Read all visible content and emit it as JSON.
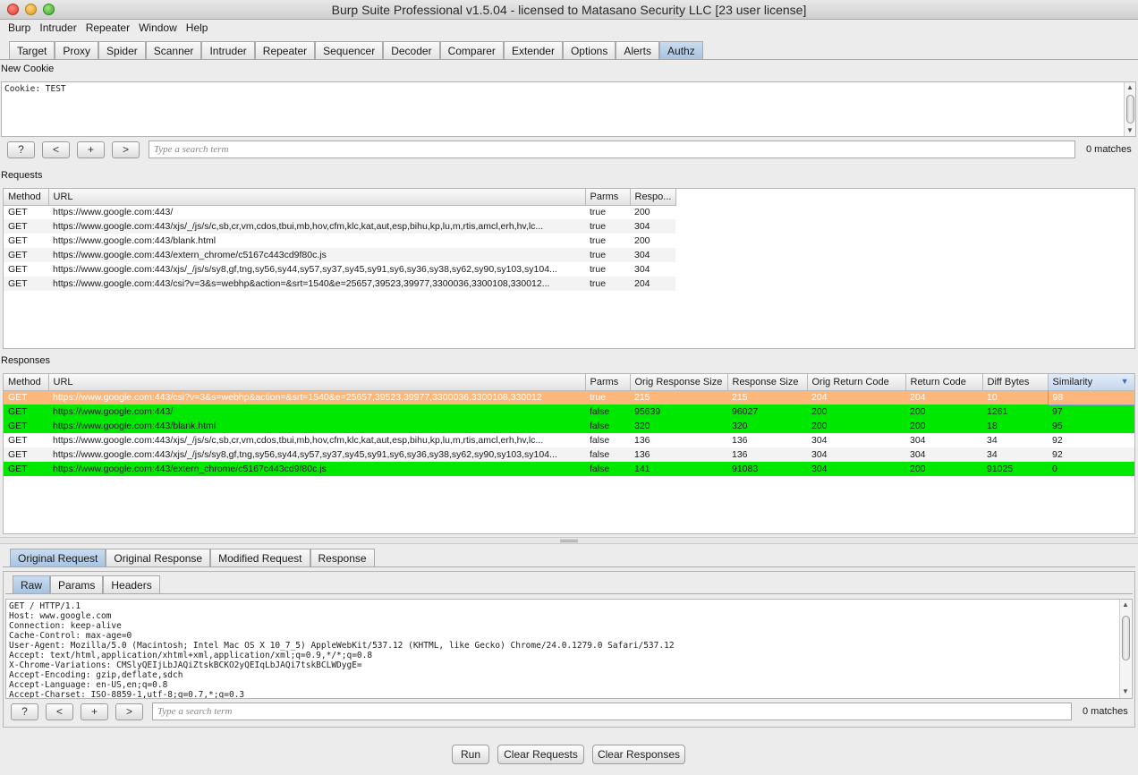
{
  "window": {
    "title": "Burp Suite Professional v1.5.04 - licensed to Matasano Security LLC [23 user license]"
  },
  "menu": [
    "Burp",
    "Intruder",
    "Repeater",
    "Window",
    "Help"
  ],
  "main_tabs": [
    "Target",
    "Proxy",
    "Spider",
    "Scanner",
    "Intruder",
    "Repeater",
    "Sequencer",
    "Decoder",
    "Comparer",
    "Extender",
    "Options",
    "Alerts",
    "Authz"
  ],
  "active_main_tab": "Authz",
  "new_cookie": {
    "label": "New Cookie",
    "value": "Cookie: TEST",
    "search": {
      "help": "?",
      "prev": "<",
      "add": "+",
      "next": ">",
      "placeholder": "Type a search term",
      "matches": "0 matches"
    }
  },
  "requests": {
    "label": "Requests",
    "columns": [
      "Method",
      "URL",
      "Parms",
      "Respo..."
    ],
    "rows": [
      [
        "GET",
        "https://www.google.com:443/",
        "true",
        "200"
      ],
      [
        "GET",
        "https://www.google.com:443/xjs/_/js/s/c,sb,cr,vm,cdos,tbui,mb,hov,cfm,klc,kat,aut,esp,bihu,kp,lu,m,rtis,amcl,erh,hv,lc...",
        "true",
        "304"
      ],
      [
        "GET",
        "https://www.google.com:443/blank.html",
        "true",
        "200"
      ],
      [
        "GET",
        "https://www.google.com:443/extern_chrome/c5167c443cd9f80c.js",
        "true",
        "304"
      ],
      [
        "GET",
        "https://www.google.com:443/xjs/_/js/s/sy8,gf,tng,sy56,sy44,sy57,sy37,sy45,sy91,sy6,sy36,sy38,sy62,sy90,sy103,sy104...",
        "true",
        "304"
      ],
      [
        "GET",
        "https://www.google.com:443/csi?v=3&s=webhp&action=&srt=1540&e=25657,39523,39977,3300036,3300108,330012...",
        "true",
        "204"
      ]
    ]
  },
  "responses": {
    "label": "Responses",
    "columns": [
      "Method",
      "URL",
      "Parms",
      "Orig Response Size",
      "Response Size",
      "Orig Return Code",
      "Return Code",
      "Diff Bytes",
      "Similarity"
    ],
    "sort_icon": "sort-descending-icon",
    "rows": [
      {
        "style": "orange",
        "cells": [
          "GET",
          "https://www.google.com:443/csi?v=3&s=webhp&action=&srt=1540&e=25657,39523,39977,3300036,3300108,330012",
          "true",
          "215",
          "215",
          "204",
          "204",
          "10",
          "98"
        ]
      },
      {
        "style": "green",
        "cells": [
          "GET",
          "https://www.google.com:443/",
          "false",
          "95639",
          "96027",
          "200",
          "200",
          "1261",
          "97"
        ]
      },
      {
        "style": "green",
        "cells": [
          "GET",
          "https://www.google.com:443/blank.html",
          "false",
          "320",
          "320",
          "200",
          "200",
          "18",
          "95"
        ]
      },
      {
        "style": "white",
        "cells": [
          "GET",
          "https://www.google.com:443/xjs/_/js/s/c,sb,cr,vm,cdos,tbui,mb,hov,cfm,klc,kat,aut,esp,bihu,kp,lu,m,rtis,amcl,erh,hv,lc...",
          "false",
          "136",
          "136",
          "304",
          "304",
          "34",
          "92"
        ]
      },
      {
        "style": "alt",
        "cells": [
          "GET",
          "https://www.google.com:443/xjs/_/js/s/sy8,gf,tng,sy56,sy44,sy57,sy37,sy45,sy91,sy6,sy36,sy38,sy62,sy90,sy103,sy104...",
          "false",
          "136",
          "136",
          "304",
          "304",
          "34",
          "92"
        ]
      },
      {
        "style": "green",
        "cells": [
          "GET",
          "https://www.google.com:443/extern_chrome/c5167c443cd9f80c.js",
          "false",
          "141",
          "91083",
          "304",
          "200",
          "91025",
          "0"
        ]
      }
    ],
    "colors": {
      "green": "#00e800",
      "orange": "#fdb77a"
    }
  },
  "detail_tabs": [
    "Original Request",
    "Original Response",
    "Modified Request",
    "Response"
  ],
  "active_detail_tab": "Original Request",
  "view_tabs": [
    "Raw",
    "Params",
    "Headers"
  ],
  "active_view_tab": "Raw",
  "request_raw": "GET / HTTP/1.1\nHost: www.google.com\nConnection: keep-alive\nCache-Control: max-age=0\nUser-Agent: Mozilla/5.0 (Macintosh; Intel Mac OS X 10_7_5) AppleWebKit/537.12 (KHTML, like Gecko) Chrome/24.0.1279.0 Safari/537.12\nAccept: text/html,application/xhtml+xml,application/xml;q=0.9,*/*;q=0.8\nX-Chrome-Variations: CMSlyQEIjLbJAQiZtskBCKO2yQEIqLbJAQi7tskBCLWDygE=\nAccept-Encoding: gzip,deflate,sdch\nAccept-Language: en-US,en;q=0.8\nAccept-Charset: ISO-8859-1,utf-8;q=0.7,*;q=0.3",
  "request_search": {
    "help": "?",
    "prev": "<",
    "add": "+",
    "next": ">",
    "placeholder": "Type a search term",
    "matches": "0 matches"
  },
  "actions": {
    "run": "Run",
    "clear_requests": "Clear Requests",
    "clear_responses": "Clear Responses"
  }
}
